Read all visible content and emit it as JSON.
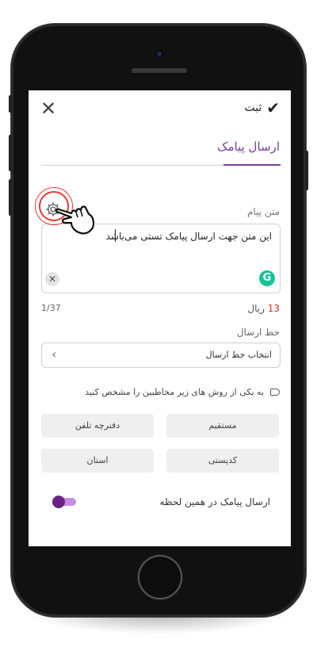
{
  "header": {
    "confirm_label": "ثبت",
    "close_icon": "close-icon",
    "check_icon": "check-icon"
  },
  "page": {
    "title": "ارسال پیامک"
  },
  "message": {
    "label": "متن پیام",
    "value": "این متن جهت ارسال پیامک تستی می‌باشد",
    "counter": "1/37",
    "price_value": "13",
    "price_unit": "ریال"
  },
  "send_line": {
    "label": "خط ارسال",
    "placeholder": "انتخاب خط ارسال"
  },
  "recipients": {
    "instruction": "به یکی از روش های زیر مخاطبین را مشخص کنید",
    "options": [
      "مستقیم",
      "دفترچه تلفن",
      "کدپستی",
      "استان"
    ]
  },
  "send_now": {
    "label": "ارسال پیامک در همین لحظه",
    "enabled": true
  },
  "colors": {
    "accent": "#7b3fa0",
    "highlight": "#e53935",
    "toggle_knob": "#6a2383",
    "toggle_track": "#c98be0",
    "grammarly": "#15c39a"
  }
}
